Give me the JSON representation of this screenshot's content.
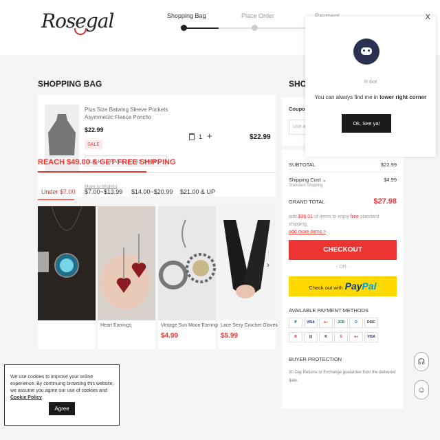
{
  "header": {
    "logo_text": "Rosegal",
    "steps": [
      "Shopping Bag",
      "Place Order",
      "Payment"
    ]
  },
  "bag": {
    "title": "SHOPPING BAG",
    "item": {
      "name": "Plus Size Batwing Sleeve Pockets Asymmetric Fleece Poncho",
      "price": "$22.99",
      "badge": "SALE",
      "variant": "LIGHT GRAY / 1X | US 14-16",
      "quantity": "1",
      "total": "$22.99",
      "wishlist": "Move to Wishlist"
    }
  },
  "promo": {
    "headline": "REACH $49.00 & GET FREE SHIPPING",
    "tabs": [
      "Under $7.00",
      "$7.00~$13.99",
      "$14.00~$20.99",
      "$21.00 & UP"
    ],
    "active_tab": 0,
    "items": [
      {
        "name": "",
        "price": ""
      },
      {
        "name": "Heart Earrings",
        "price": ""
      },
      {
        "name": "Vintage Sun Moon Earrings",
        "price": "$4.99"
      },
      {
        "name": "Lace Sexy Crochet Gloves",
        "price": "$5.99"
      }
    ]
  },
  "coupon": {
    "title": "Coupon",
    "placeholder": "Use a c"
  },
  "summary": {
    "title_partial": "SHOP",
    "subtotal_label": "SUBTOTAL",
    "subtotal": "$22.99",
    "shipping_label": "Shipping Cost",
    "shipping_sub": "Standard Shipping",
    "shipping": "$4.99",
    "grand_label": "GRAND TOTAL",
    "grand_total": "$27.98",
    "note_prefix": "add ",
    "note_amount": "$36.01",
    "note_middle": " of items to enjoy ",
    "note_free": "free",
    "note_suffix": " standard shipping,",
    "note_link": "add more items >",
    "checkout": "CHECKOUT",
    "or": "- OR -",
    "paypal_prefix": "Check out with",
    "paypal_a": "Pay",
    "paypal_b": "Pal",
    "payment_title": "AVAILABLE PAYMENT METHODS",
    "payment_methods": [
      "PayPal",
      "VISA",
      "MC",
      "JCB",
      "Diners",
      "DISCOVER",
      "Boleto",
      "Barcode",
      "Klarna",
      "Sofort",
      "Maestro",
      "VISA"
    ],
    "buyer_title": "BUYER PROTECTION",
    "buyer_note": "30 Day Returns or Exchange guarantee from the delivered date."
  },
  "popup": {
    "name": "R-bot",
    "msg_prefix": "You can always find me in ",
    "msg_bold": "lower right corner",
    "button": "Ok, See ya!",
    "close": "X"
  },
  "cookie": {
    "text": "We use cookies to improve your online experience. By continuing browsing this website, we assume you agree our use of cookies and ",
    "link": "Cookie Policy",
    "after": ".",
    "button": "Agree"
  },
  "colors": {
    "accent": "#e33333",
    "paypal_yellow": "#ffd800",
    "dark": "#1a1a1a"
  }
}
